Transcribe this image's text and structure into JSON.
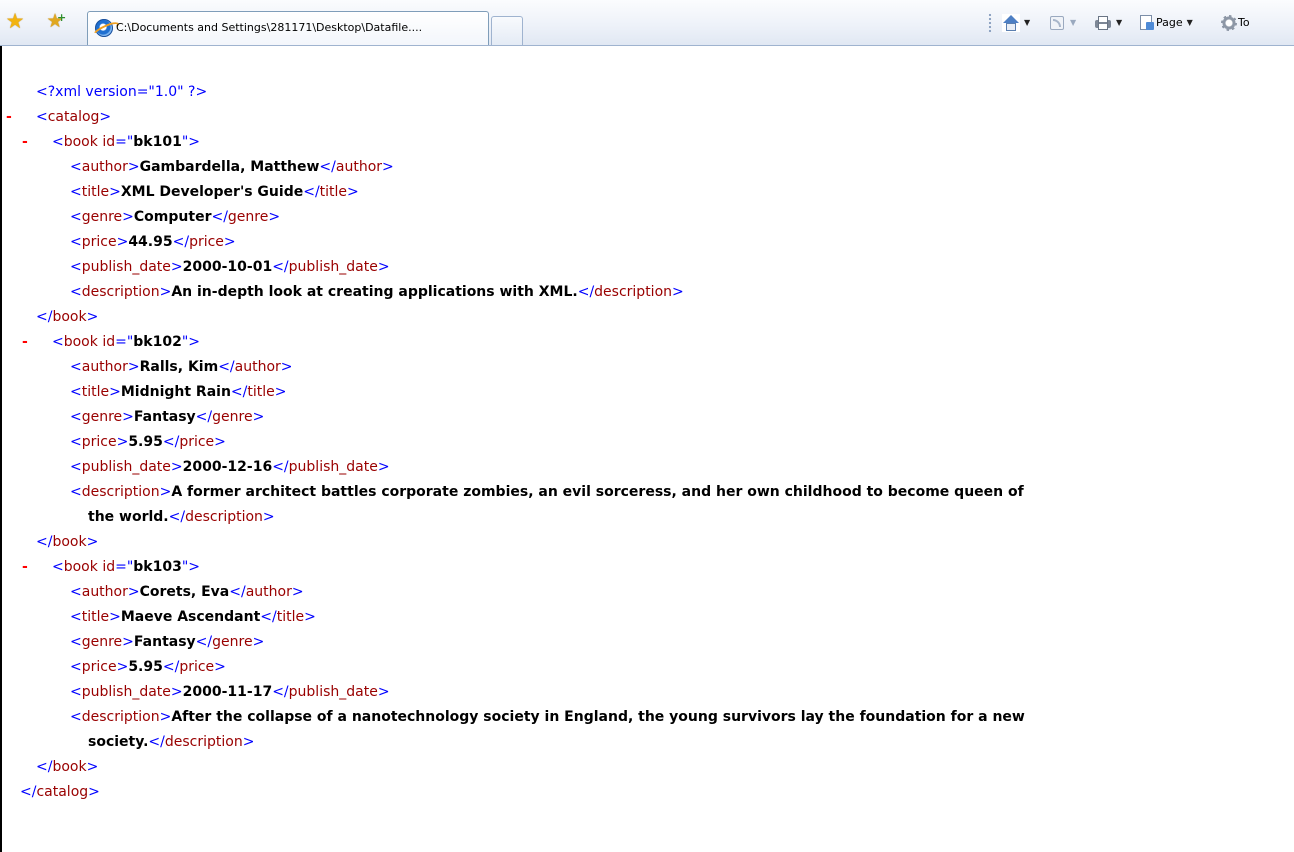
{
  "toolbar": {
    "tab_title": "C:\\Documents and Settings\\281171\\Desktop\\Datafile....",
    "page_label": "Page",
    "tools_label": "To",
    "colors": {
      "star": "#f2b310",
      "tab_border": "#7f9db9"
    }
  },
  "xml": {
    "declaration": "<?xml version=\"1.0\" ?>",
    "collapse_glyph": "-",
    "root_name": "catalog",
    "books": [
      {
        "id": "bk101",
        "author": "Gambardella, Matthew",
        "title": "XML Developer's Guide",
        "genre": "Computer",
        "price": "44.95",
        "publish_date": "2000-10-01",
        "description_lines": [
          "An in-depth look at creating applications with XML."
        ]
      },
      {
        "id": "bk102",
        "author": "Ralls, Kim",
        "title": "Midnight Rain",
        "genre": "Fantasy",
        "price": "5.95",
        "publish_date": "2000-12-16",
        "description_lines": [
          "A former architect battles corporate zombies, an evil sorceress, and her own childhood to become queen of",
          "the world."
        ]
      },
      {
        "id": "bk103",
        "author": "Corets, Eva",
        "title": "Maeve Ascendant",
        "genre": "Fantasy",
        "price": "5.95",
        "publish_date": "2000-11-17",
        "description_lines": [
          "After the collapse of a nanotechnology society in England, the young survivors lay the foundation for a new",
          "society."
        ]
      }
    ],
    "colors": {
      "markup": "#0000ff",
      "tag_name": "#990000",
      "text": "#000000",
      "collapse": "#ff0000"
    }
  }
}
